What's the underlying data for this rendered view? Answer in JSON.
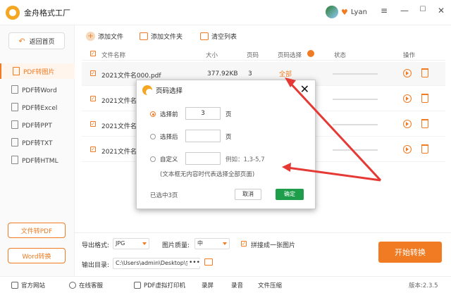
{
  "app": {
    "title": "金舟格式工厂",
    "username": "Lyan",
    "colors": {
      "accent": "#f07b22",
      "ok": "#1e9e4a",
      "arrow": "#e53935"
    }
  },
  "window": {
    "minimize": "—",
    "maximize": "☐",
    "close": "✕",
    "menu": "≡"
  },
  "sidebar": {
    "back_label": "返回首页",
    "items": [
      {
        "label": "PDF转图片",
        "active": true
      },
      {
        "label": "PDF转Word"
      },
      {
        "label": "PDF转Excel"
      },
      {
        "label": "PDF转PPT"
      },
      {
        "label": "PDF转TXT"
      },
      {
        "label": "PDF转HTML"
      }
    ],
    "file_to_pdf": "文件转PDF",
    "word_convert": "Word转换"
  },
  "toolbar": {
    "add_file": "添加文件",
    "add_folder": "添加文件夹",
    "clear_list": "清空列表"
  },
  "table": {
    "headers": {
      "name": "文件名称",
      "size": "大小",
      "pages": "页码",
      "page_select": "页码选择",
      "status": "状态",
      "ops": "操作"
    },
    "rows": [
      {
        "name": "2021文件名000.pdf",
        "size": "377.92KB",
        "pages": "3",
        "select": "全部"
      },
      {
        "name": "2021文件名"
      },
      {
        "name": "2021文件名"
      },
      {
        "name": "2021文件名"
      }
    ]
  },
  "bottom": {
    "format_label": "导出格式:",
    "format_value": "JPG",
    "quality_label": "图片质量:",
    "quality_value": "中",
    "stitch_label": "拼接成一张图片",
    "output_label": "输出目录:",
    "output_value": "C:\\Users\\admin\\Desktop\\金",
    "more": "•••",
    "start": "开始转换"
  },
  "footer": {
    "website": "官方网站",
    "support": "在线客服",
    "printer": "PDF虚拟打印机",
    "record": "录屏",
    "audio": "录音",
    "compress": "文件压缩",
    "version": "版本:2.3.5"
  },
  "dialog": {
    "title": "页码选择",
    "before_label": "选择前",
    "before_value": "3",
    "page_unit": "页",
    "after_label": "选择后",
    "after_value": "",
    "custom_label": "自定义",
    "custom_example": "例如：1,3-5,7",
    "hint": "(文本框无内容时代表选择全部页面)",
    "selected": "已选中3页",
    "cancel": "取消",
    "ok": "确定"
  }
}
